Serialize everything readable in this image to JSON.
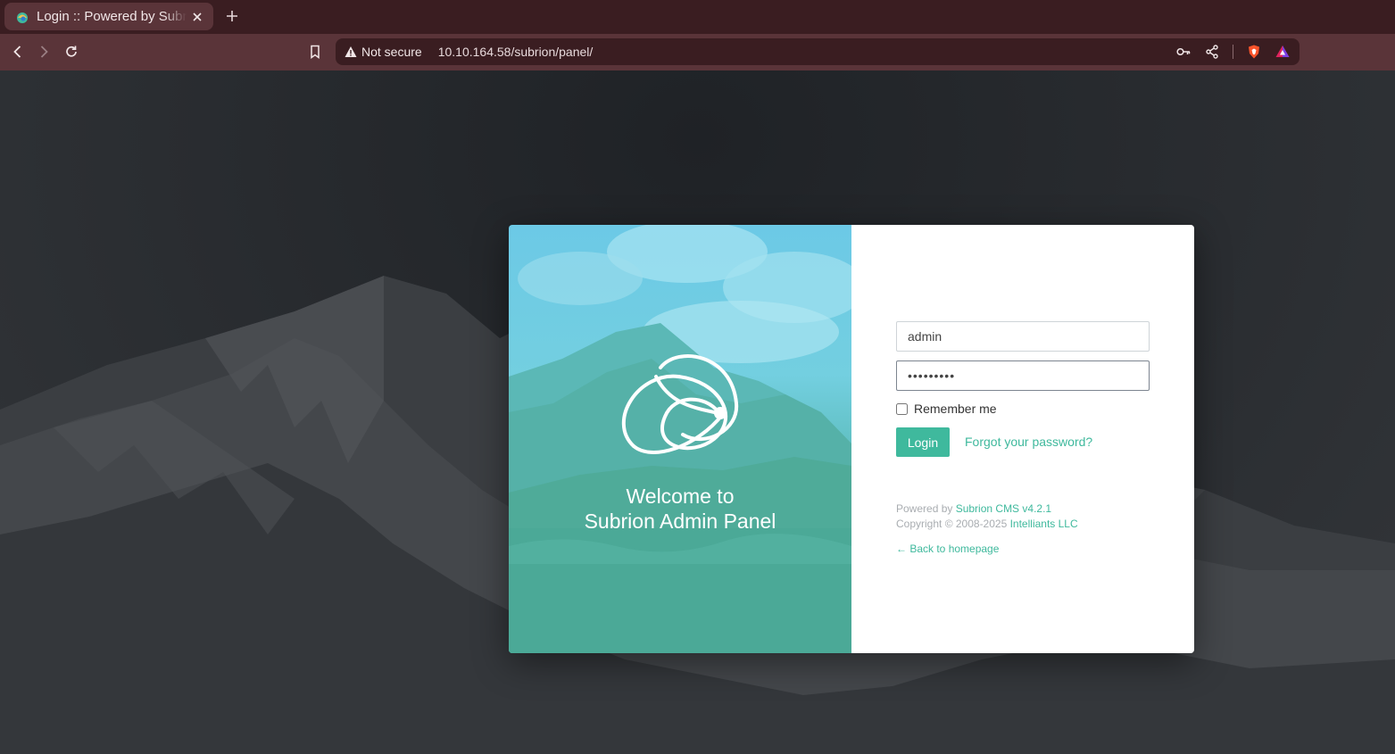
{
  "browser": {
    "tab_title": "Login :: Powered by Subrion CMS",
    "security_label": "Not secure",
    "url": "10.10.164.58/subrion/panel/"
  },
  "hero": {
    "welcome_line1": "Welcome to",
    "welcome_line2": "Subrion Admin Panel"
  },
  "form": {
    "username_value": "admin",
    "password_value": "•••••••••",
    "remember_label": "Remember me",
    "remember_checked": false,
    "login_label": "Login",
    "forgot_label": "Forgot your password?"
  },
  "footer": {
    "powered_prefix": "Powered by ",
    "powered_link": "Subrion CMS v4.2.1",
    "copyright_prefix": "Copyright © 2008-2025 ",
    "copyright_link": "Intelliants LLC",
    "back_label": "← Back to homepage"
  },
  "colors": {
    "accent": "#3fb99d",
    "tabbar": "#3a1d21",
    "toolbar": "#5a3439"
  },
  "icons": [
    "back-icon",
    "forward-icon",
    "reload-icon",
    "bookmark-icon",
    "warning-icon",
    "key-icon",
    "share-icon",
    "brave-shield-icon",
    "brave-rewards-icon",
    "close-icon",
    "plus-icon",
    "subrion-logo"
  ]
}
